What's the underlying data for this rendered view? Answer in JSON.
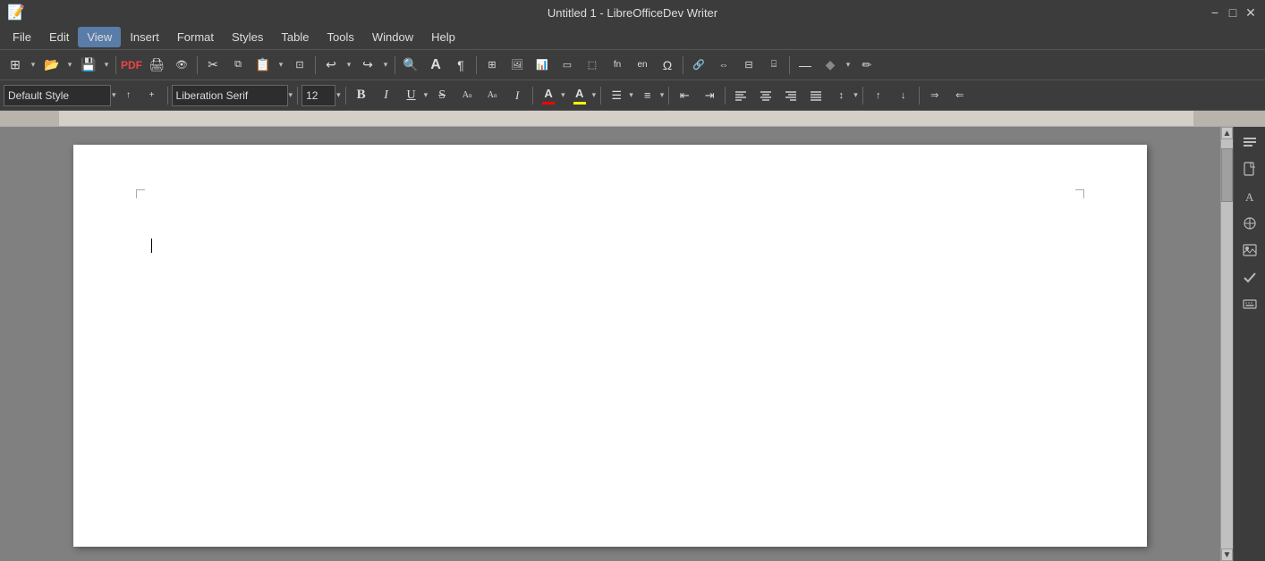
{
  "titlebar": {
    "title": "Untitled 1 - LibreOfficeDev Writer",
    "close_btn": "✕",
    "minimize_btn": "−",
    "maximize_btn": "□"
  },
  "menubar": {
    "items": [
      "File",
      "Edit",
      "View",
      "Insert",
      "Format",
      "Styles",
      "Table",
      "Tools",
      "Window",
      "Help"
    ]
  },
  "toolbar1": {
    "buttons": [
      {
        "name": "new",
        "icon": "⊞",
        "label": "New"
      },
      {
        "name": "open",
        "icon": "📂",
        "label": "Open"
      },
      {
        "name": "save",
        "icon": "💾",
        "label": "Save"
      },
      {
        "name": "export-pdf",
        "icon": "📄",
        "label": "Export PDF"
      },
      {
        "name": "print",
        "icon": "🖨",
        "label": "Print"
      },
      {
        "name": "print-preview",
        "icon": "👁",
        "label": "Print Preview"
      },
      {
        "name": "cut",
        "icon": "✂",
        "label": "Cut"
      },
      {
        "name": "copy",
        "icon": "⧉",
        "label": "Copy"
      },
      {
        "name": "paste",
        "icon": "📋",
        "label": "Paste"
      },
      {
        "name": "clone-format",
        "icon": "⊡",
        "label": "Clone Formatting"
      },
      {
        "name": "undo",
        "icon": "↩",
        "label": "Undo"
      },
      {
        "name": "redo",
        "icon": "↪",
        "label": "Redo"
      },
      {
        "name": "find",
        "icon": "🔍",
        "label": "Find"
      },
      {
        "name": "large-font",
        "icon": "A",
        "label": "Increase Font Size"
      },
      {
        "name": "pilcrow",
        "icon": "¶",
        "label": "Toggle Formatting Marks"
      },
      {
        "name": "table",
        "icon": "⊞",
        "label": "Insert Table"
      },
      {
        "name": "image",
        "icon": "🖼",
        "label": "Insert Image"
      },
      {
        "name": "chart",
        "icon": "📊",
        "label": "Insert Chart"
      },
      {
        "name": "textbox",
        "icon": "▭",
        "label": "Insert Text Box"
      },
      {
        "name": "frame",
        "icon": "⬚",
        "label": "Insert Frame"
      },
      {
        "name": "footnote",
        "icon": "fn",
        "label": "Insert Footnote"
      },
      {
        "name": "endnote",
        "icon": "en",
        "label": "Insert Endnote"
      },
      {
        "name": "special-char",
        "icon": "Ω",
        "label": "Insert Special Character"
      },
      {
        "name": "hyperlink",
        "icon": "🔗",
        "label": "Insert Hyperlink"
      },
      {
        "name": "cross-ref",
        "icon": "⇔",
        "label": "Cross Reference"
      },
      {
        "name": "header-footer",
        "icon": "⊟",
        "label": "Header/Footer"
      },
      {
        "name": "field",
        "icon": "⌸",
        "label": "Insert Field"
      },
      {
        "name": "line",
        "icon": "—",
        "label": "Insert Line"
      },
      {
        "name": "shapes",
        "icon": "◆",
        "label": "Basic Shapes"
      },
      {
        "name": "draw",
        "icon": "✏",
        "label": "Draw"
      }
    ]
  },
  "formattoolbar": {
    "style_value": "Default Style",
    "style_placeholder": "Default Style",
    "font_value": "Liberation Serif",
    "font_placeholder": "Liberation Serif",
    "size_value": "12",
    "size_placeholder": "12",
    "bold_label": "B",
    "italic_label": "I",
    "underline_label": "U",
    "strikethrough_label": "S",
    "superscript_label": "A",
    "subscript_label": "A",
    "shadow_label": "I",
    "fontcolor_label": "A",
    "highlight_label": "A",
    "list_unordered_label": "≡",
    "list_ordered_label": "≡",
    "indent_label": "⇥",
    "outdent_label": "⇤",
    "align_left_label": "≡",
    "align_center_label": "≡",
    "align_right_label": "≡",
    "align_justify_label": "≡",
    "linespacing_label": "≡",
    "increase_spacing_label": "↕",
    "decrease_spacing_label": "↕",
    "ltr_label": "⇒",
    "rtl_label": "⇐",
    "font_color": "#ff0000",
    "highlight_color": "#ffff00"
  },
  "sidebar": {
    "buttons": [
      "⊡",
      "📄",
      "📝",
      "⊙",
      "🖼",
      "✓",
      "⌨"
    ]
  },
  "page": {
    "title": ""
  }
}
